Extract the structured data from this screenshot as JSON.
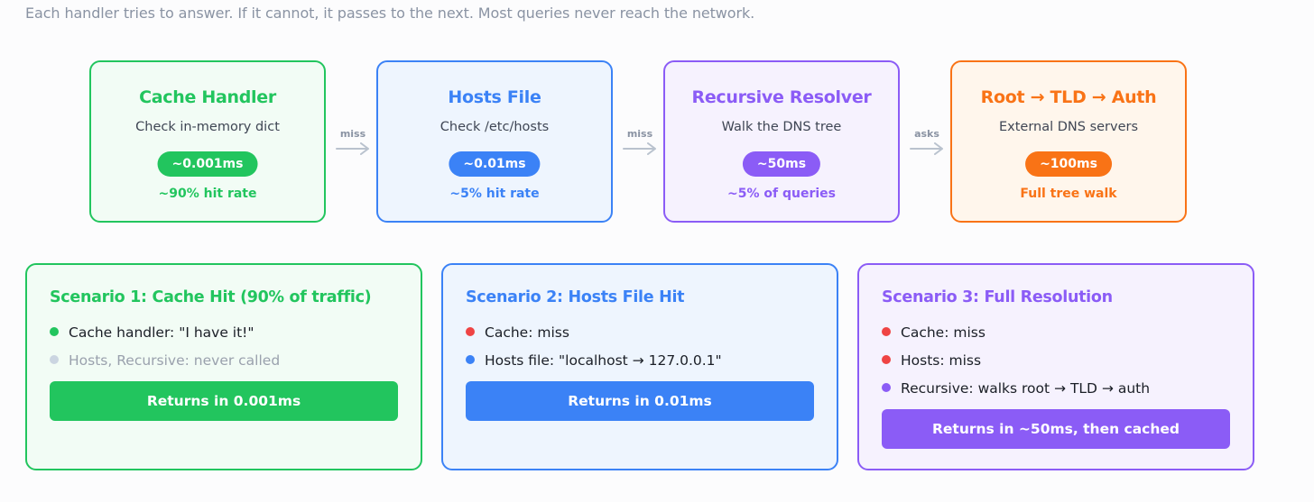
{
  "intro": "Each handler tries to answer. If it cannot, it passes to the next. Most queries never reach the network.",
  "colors": {
    "green": "#22c55e",
    "blue": "#3b82f6",
    "purple": "#8b5cf6",
    "orange": "#f97316",
    "red": "#ef4444",
    "gray": "#cbd5e1"
  },
  "handlers": [
    {
      "title": "Cache Handler",
      "subtitle": "Check in-memory dict",
      "latency": "~0.001ms",
      "note": "~90% hit rate"
    },
    {
      "title": "Hosts File",
      "subtitle": "Check /etc/hosts",
      "latency": "~0.01ms",
      "note": "~5% hit rate"
    },
    {
      "title": "Recursive Resolver",
      "subtitle": "Walk the DNS tree",
      "latency": "~50ms",
      "note": "~5% of queries"
    },
    {
      "title": "Root → TLD → Auth",
      "subtitle": "External DNS servers",
      "latency": "~100ms",
      "note": "Full tree walk"
    }
  ],
  "arrows": [
    {
      "label": "miss"
    },
    {
      "label": "miss"
    },
    {
      "label": "asks"
    }
  ],
  "scenarios": [
    {
      "title": "Scenario 1: Cache Hit (90% of traffic)",
      "items": [
        {
          "text": "Cache handler: \"I have it!\"",
          "dot": "green"
        },
        {
          "text": "Hosts, Recursive: never called",
          "dot": "gray"
        }
      ],
      "result": "Returns in 0.001ms"
    },
    {
      "title": "Scenario 2: Hosts File Hit",
      "items": [
        {
          "text": "Cache: miss",
          "dot": "red"
        },
        {
          "text": "Hosts file: \"localhost → 127.0.0.1\"",
          "dot": "blue"
        }
      ],
      "result": "Returns in 0.01ms"
    },
    {
      "title": "Scenario 3: Full Resolution",
      "items": [
        {
          "text": "Cache: miss",
          "dot": "red"
        },
        {
          "text": "Hosts: miss",
          "dot": "red"
        },
        {
          "text": "Recursive: walks root → TLD → auth",
          "dot": "purple"
        }
      ],
      "result": "Returns in ~50ms, then cached"
    }
  ]
}
